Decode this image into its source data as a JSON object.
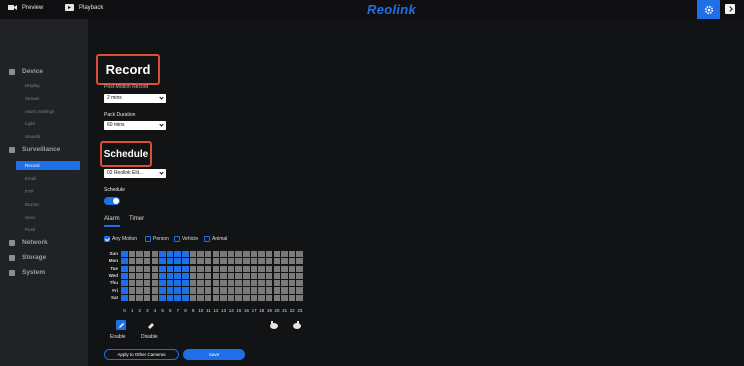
{
  "topbar": {
    "preview_label": "Preview",
    "playback_label": "Playback",
    "brand": "Reolink"
  },
  "sidebar": {
    "sections": [
      {
        "label": "Device",
        "items": [
          "Display",
          "Stream",
          "Alarm Settings",
          "Light",
          "Sounds"
        ]
      },
      {
        "label": "Surveillance",
        "items": [
          "Record",
          "Email",
          "FTP",
          "Buzzer",
          "Siren",
          "Push"
        ]
      },
      {
        "label": "Network",
        "items": []
      },
      {
        "label": "Storage",
        "items": []
      },
      {
        "label": "System",
        "items": []
      }
    ],
    "active_item": "Record"
  },
  "main": {
    "record_heading": "Record",
    "post_motion_label": "Post-Motion Record",
    "post_motion_value": "2 mins",
    "pack_duration_label": "Pack Duration",
    "pack_duration_value": "60 mins",
    "schedule_heading": "Schedule",
    "camera_value": "02  Reolink Elit...",
    "schedule_label": "Schedule",
    "schedule_enabled": true,
    "tabs": [
      "Alarm",
      "Timer"
    ],
    "active_tab": "Alarm",
    "filters": [
      {
        "label": "Any Motion",
        "checked": true
      },
      {
        "label": "Person",
        "checked": false
      },
      {
        "label": "Vehicle",
        "checked": false
      },
      {
        "label": "Animal",
        "checked": false
      }
    ],
    "days": [
      "Sun",
      "Mon",
      "Tue",
      "Wed",
      "Thu",
      "Fri",
      "Sat"
    ],
    "hours": [
      "0",
      "1",
      "2",
      "3",
      "4",
      "5",
      "6",
      "7",
      "8",
      "9",
      "10",
      "11",
      "12",
      "13",
      "14",
      "15",
      "16",
      "17",
      "18",
      "19",
      "20",
      "21",
      "22",
      "23"
    ],
    "active_hours": [
      0,
      5,
      6,
      7,
      8
    ],
    "enable_label": "Enable",
    "disable_label": "Disable",
    "apply_button": "Apply to Other Cameras",
    "save_button": "Save"
  },
  "colors": {
    "accent": "#1e6fe8",
    "highlight": "#e04b3a",
    "inactive_cell": "#7a7a7a"
  }
}
